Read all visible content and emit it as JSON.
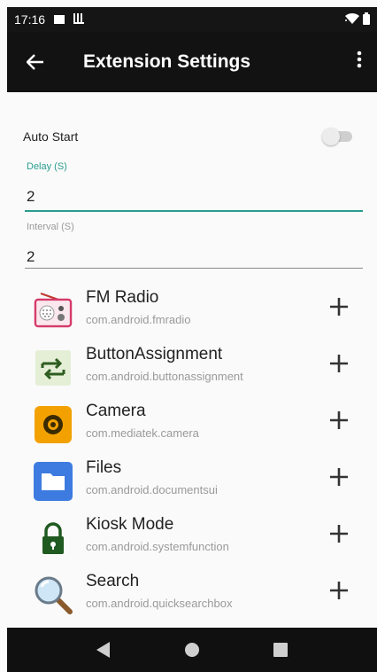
{
  "status_bar": {
    "time": "17:16"
  },
  "app_bar": {
    "title": "Extension Settings",
    "back_icon": "arrow-left-icon",
    "menu_icon": "more-vert-icon"
  },
  "settings": {
    "auto_start": {
      "label": "Auto Start",
      "enabled": false
    },
    "delay": {
      "label": "Delay (S)",
      "value": "2"
    },
    "interval": {
      "label": "Interval (S)",
      "value": "2"
    }
  },
  "apps": [
    {
      "name": "FM Radio",
      "package": "com.android.fmradio",
      "icon": "fm-radio-icon"
    },
    {
      "name": "ButtonAssignment",
      "package": "com.android.buttonassignment",
      "icon": "button-assignment-icon"
    },
    {
      "name": "Camera",
      "package": "com.mediatek.camera",
      "icon": "camera-icon"
    },
    {
      "name": "Files",
      "package": "com.android.documentsui",
      "icon": "files-icon"
    },
    {
      "name": "Kiosk Mode",
      "package": "com.android.systemfunction",
      "icon": "kiosk-lock-icon"
    },
    {
      "name": "Search",
      "package": "com.android.quicksearchbox",
      "icon": "search-icon"
    }
  ],
  "colors": {
    "accent": "#2a9d8f",
    "app_bar": "#121212",
    "background": "#fafafa"
  }
}
